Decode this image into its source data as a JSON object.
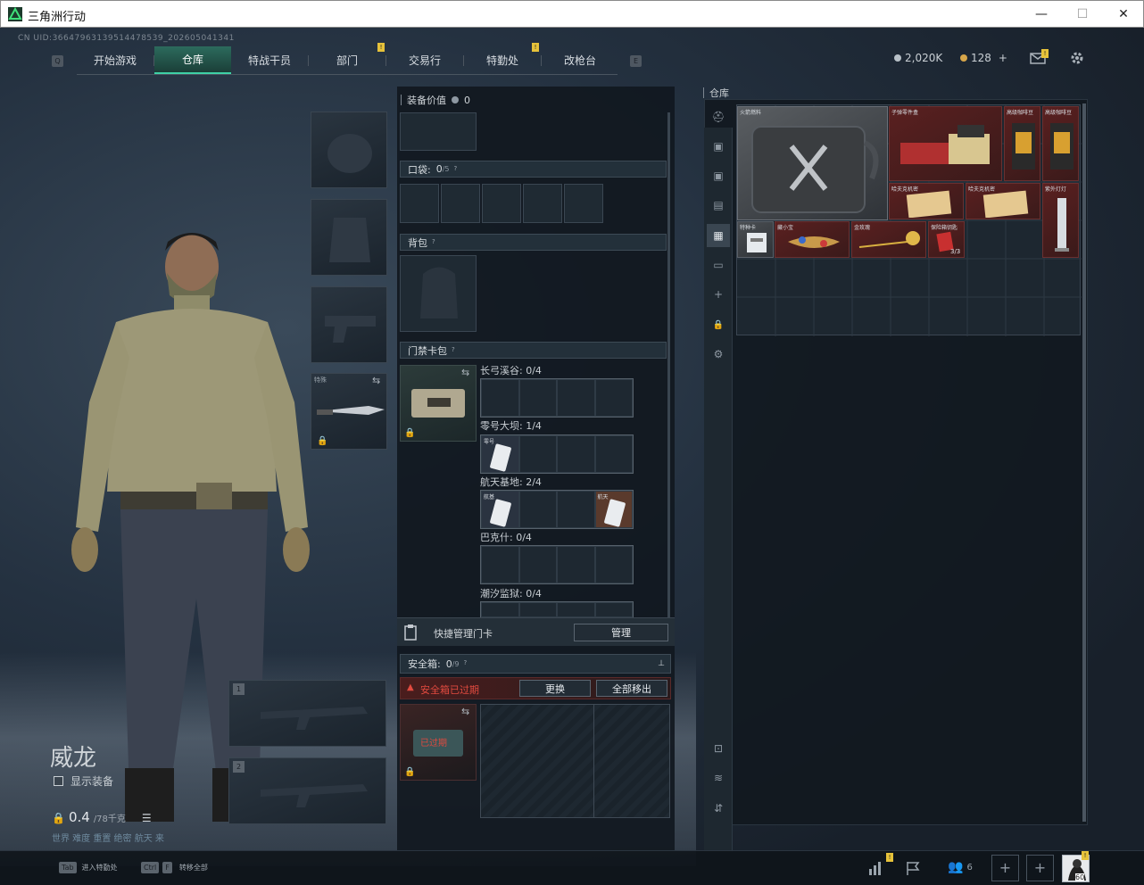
{
  "window": {
    "title": "三角洲行动",
    "minimize": "—",
    "maximize": "☐",
    "close": "✕"
  },
  "header": {
    "uid": "CN UID:3664796313951447853​9_202605041341",
    "nav_key_left": "Q",
    "nav_key_right": "E",
    "tabs": [
      {
        "label": "开始游戏",
        "active": false
      },
      {
        "label": "仓库",
        "active": true
      },
      {
        "label": "特战干员",
        "active": false
      },
      {
        "label": "部门",
        "active": false
      },
      {
        "label": "交易行",
        "active": false
      },
      {
        "label": "特勤处",
        "active": false
      },
      {
        "label": "改枪台",
        "active": false
      }
    ],
    "badge": "!",
    "currency_coins": "2,020K",
    "currency_premium": "128",
    "currency_add": "+"
  },
  "character": {
    "name": "威龙",
    "show_equipment_label": "显示装备",
    "weight": "0.4",
    "weight_max": "/78千克",
    "footer_text": "世界 难度 重置 绝密 航天 来",
    "knife_label": "特殊",
    "weapon_slot_1": "1",
    "weapon_slot_2": "2"
  },
  "loadout": {
    "equip_value_label": "装备价值",
    "equip_value": "0",
    "pocket_label": "口袋:",
    "pocket_count": "0",
    "pocket_max": "/5",
    "backpack_label": "背包",
    "keycard_label": "门禁卡包",
    "help": "?",
    "maps": [
      {
        "name": "长弓溪谷: 0/4",
        "items": []
      },
      {
        "name": "零号大坝: 1/4",
        "items": [
          "零号"
        ]
      },
      {
        "name": "航天基地: 2/4",
        "items": [
          "航基",
          "航天"
        ]
      },
      {
        "name": "巴克什: 0/4",
        "items": []
      },
      {
        "name": "潮汐监狱: 0/4",
        "items": []
      }
    ],
    "quick_manage_label": "快捷管理门卡",
    "manage_button": "管理",
    "safebox_label": "安全箱:",
    "safebox_count": "0",
    "safebox_max": "/9",
    "pin_icon": "📌",
    "safebox_expired_warning": "安全箱已过期",
    "replace_button": "更换",
    "move_all_button": "全部移出",
    "safebox_item_status": "已过期"
  },
  "warehouse": {
    "title": "仓库",
    "items": [
      {
        "name": "火箭燃料"
      },
      {
        "name": "子弹零件盒"
      },
      {
        "name": "高级咖啡豆"
      },
      {
        "name": "高级咖啡豆"
      },
      {
        "name": "哈夫克机密"
      },
      {
        "name": "哈夫克机密"
      },
      {
        "name": "紫外灯灯"
      },
      {
        "name": "特种卡"
      },
      {
        "name": "藏小宝"
      },
      {
        "name": "金玫瑰"
      },
      {
        "name": "保险箱钥匙",
        "count": "3/3"
      }
    ],
    "side_icons": [
      "helmet-icon",
      "armor-icon",
      "rig-icon",
      "box-icon",
      "case-icon",
      "folder-icon",
      "plus-icon",
      "lock-icon",
      "gear-icon",
      "sort-icon",
      "layers-icon",
      "transfer-icon"
    ]
  },
  "bottom": {
    "tab_key": "Tab",
    "tab_hint": "进入特勤处",
    "ctrl_key": "Ctrl",
    "f_key": "F",
    "ctrl_hint": "转移全部",
    "friends_count": "6",
    "avatar_level": "60"
  },
  "colors": {
    "accent": "#3fd0a6",
    "warning": "#d9342b",
    "badge": "#e6c23a",
    "panel": "#11181f"
  }
}
